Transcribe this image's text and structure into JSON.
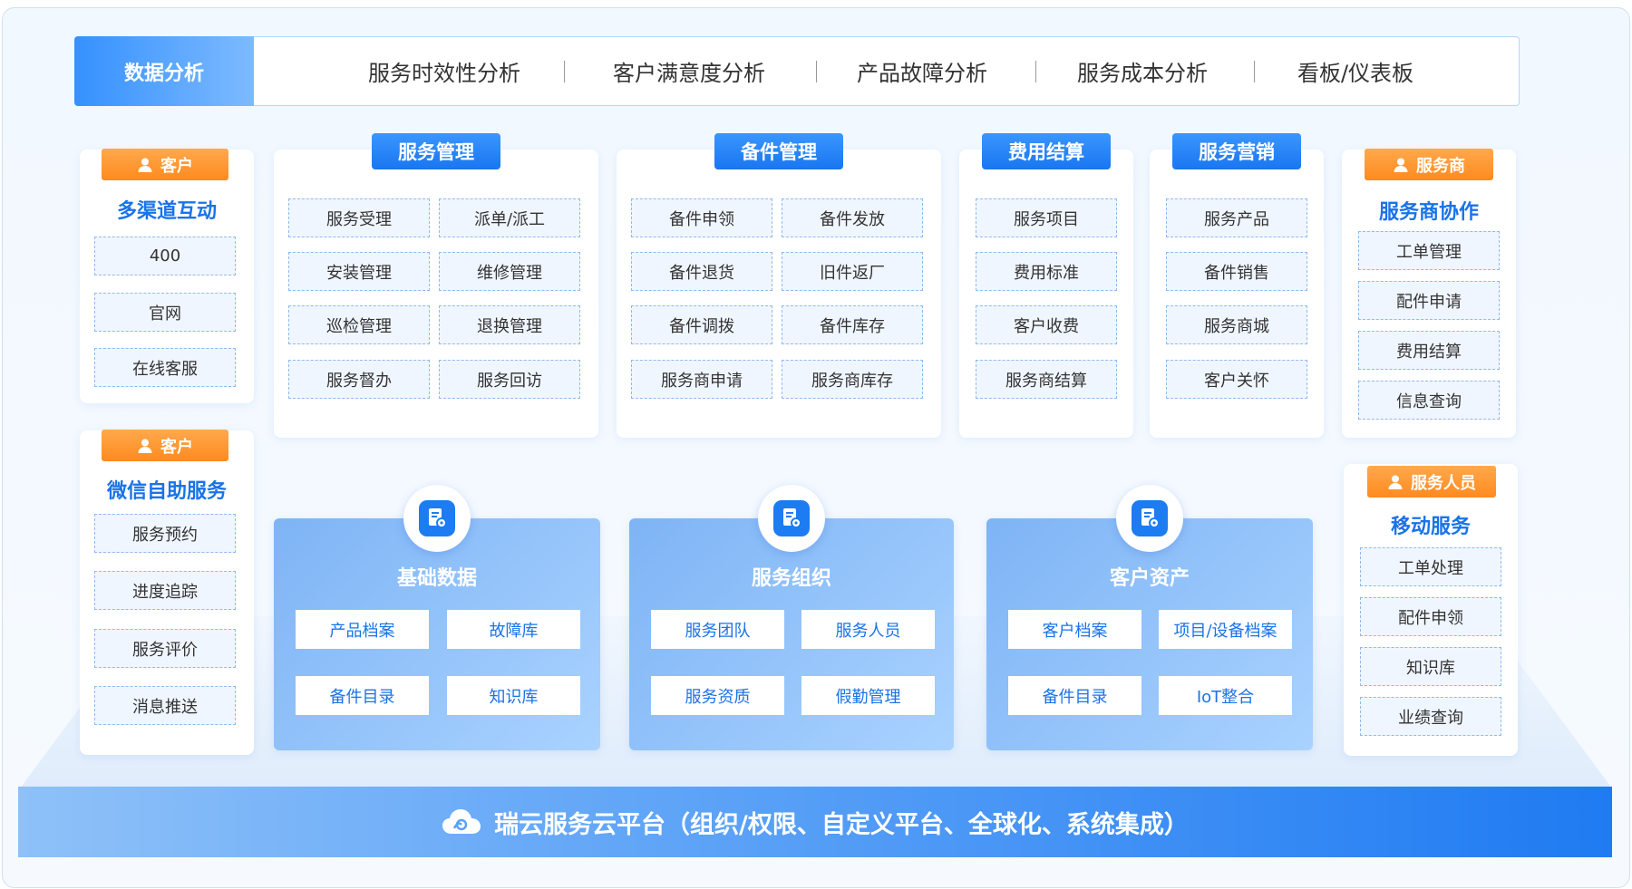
{
  "top_bar": {
    "title": "数据分析",
    "tabs": [
      "服务时效性分析",
      "客户满意度分析",
      "产品故障分析",
      "服务成本分析",
      "看板/仪表板"
    ]
  },
  "left_cards": [
    {
      "role": "客户",
      "title": "多渠道互动",
      "items": [
        "400",
        "官网",
        "在线客服"
      ]
    },
    {
      "role": "客户",
      "title": "微信自助服务",
      "items": [
        "服务预约",
        "进度追踪",
        "服务评价",
        "消息推送"
      ]
    }
  ],
  "modules": [
    {
      "title": "服务管理",
      "items": [
        "服务受理",
        "派单/派工",
        "安装管理",
        "维修管理",
        "巡检管理",
        "退换管理",
        "服务督办",
        "服务回访"
      ]
    },
    {
      "title": "备件管理",
      "items": [
        "备件申领",
        "备件发放",
        "备件退货",
        "旧件返厂",
        "备件调拨",
        "备件库存",
        "服务商申请",
        "服务商库存"
      ]
    },
    {
      "title": "费用结算",
      "items": [
        "服务项目",
        "费用标准",
        "客户收费",
        "服务商结算"
      ]
    },
    {
      "title": "服务营销",
      "items": [
        "服务产品",
        "备件销售",
        "服务商城",
        "客户关怀"
      ]
    }
  ],
  "right_cards": [
    {
      "role": "服务商",
      "title": "服务商协作",
      "items": [
        "工单管理",
        "配件申请",
        "费用结算",
        "信息查询"
      ]
    },
    {
      "role": "服务人员",
      "title": "移动服务",
      "items": [
        "工单处理",
        "配件申领",
        "知识库",
        "业绩查询"
      ]
    }
  ],
  "foundation": [
    {
      "title": "基础数据",
      "icon": "document-gear-icon",
      "items": [
        "产品档案",
        "故障库",
        "备件目录",
        "知识库"
      ]
    },
    {
      "title": "服务组织",
      "icon": "document-gear-icon",
      "items": [
        "服务团队",
        "服务人员",
        "服务资质",
        "假勤管理"
      ]
    },
    {
      "title": "客户资产",
      "icon": "document-gear-icon",
      "items": [
        "客户档案",
        "项目/设备档案",
        "备件目录",
        "IoT整合"
      ]
    }
  ],
  "platform": {
    "icon": "cloud-icon",
    "label": "瑞云服务云平台（组织/权限、自定义平台、全球化、系统集成）"
  },
  "colors": {
    "primary": "#1d7cf2",
    "accent_orange": "#ff8a1f",
    "light_blue": "#a9d2ff"
  }
}
